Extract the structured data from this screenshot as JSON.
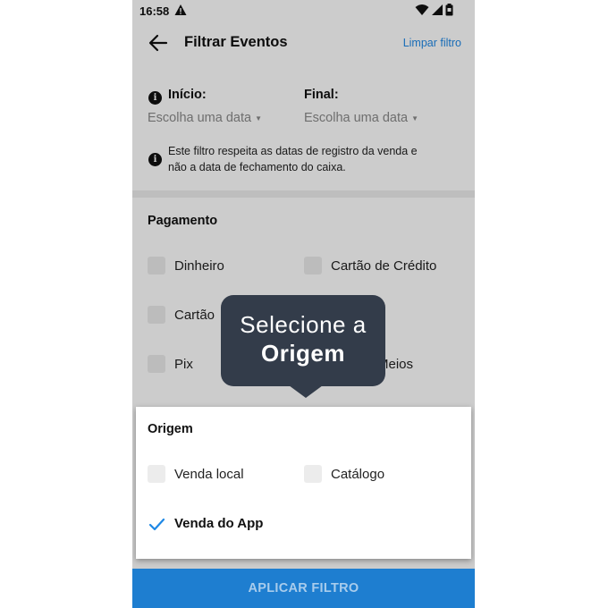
{
  "status_bar": {
    "time": "16:58"
  },
  "header": {
    "title": "Filtrar Eventos",
    "clear_label": "Limpar filtro"
  },
  "dates": {
    "start_label": "Início:",
    "end_label": "Final:",
    "start_placeholder": "Escolha uma data",
    "end_placeholder": "Escolha uma data"
  },
  "info_note": {
    "line1": "Este filtro respeita as datas de registro da venda e",
    "line2": "não a data de fechamento do caixa."
  },
  "payment": {
    "title": "Pagamento",
    "options": [
      {
        "label": "Dinheiro",
        "checked": false
      },
      {
        "label": "Cartão de Crédito",
        "checked": false
      },
      {
        "label": "Cartão",
        "checked": false
      },
      {
        "label": "Pix",
        "checked": false
      },
      {
        "label": "Meios",
        "checked": false
      }
    ]
  },
  "origin": {
    "title": "Origem",
    "options": [
      {
        "label": "Venda local",
        "checked": false
      },
      {
        "label": "Catálogo",
        "checked": false
      },
      {
        "label": "Venda do App",
        "checked": true
      }
    ]
  },
  "apply_button": {
    "label": "APLICAR FILTRO"
  },
  "tooltip": {
    "line1": "Selecione a",
    "line2": "Origem"
  },
  "colors": {
    "accent": "#1e88e5",
    "apply_bg": "#1e7ed0",
    "tooltip_bg": "#333c4a"
  }
}
